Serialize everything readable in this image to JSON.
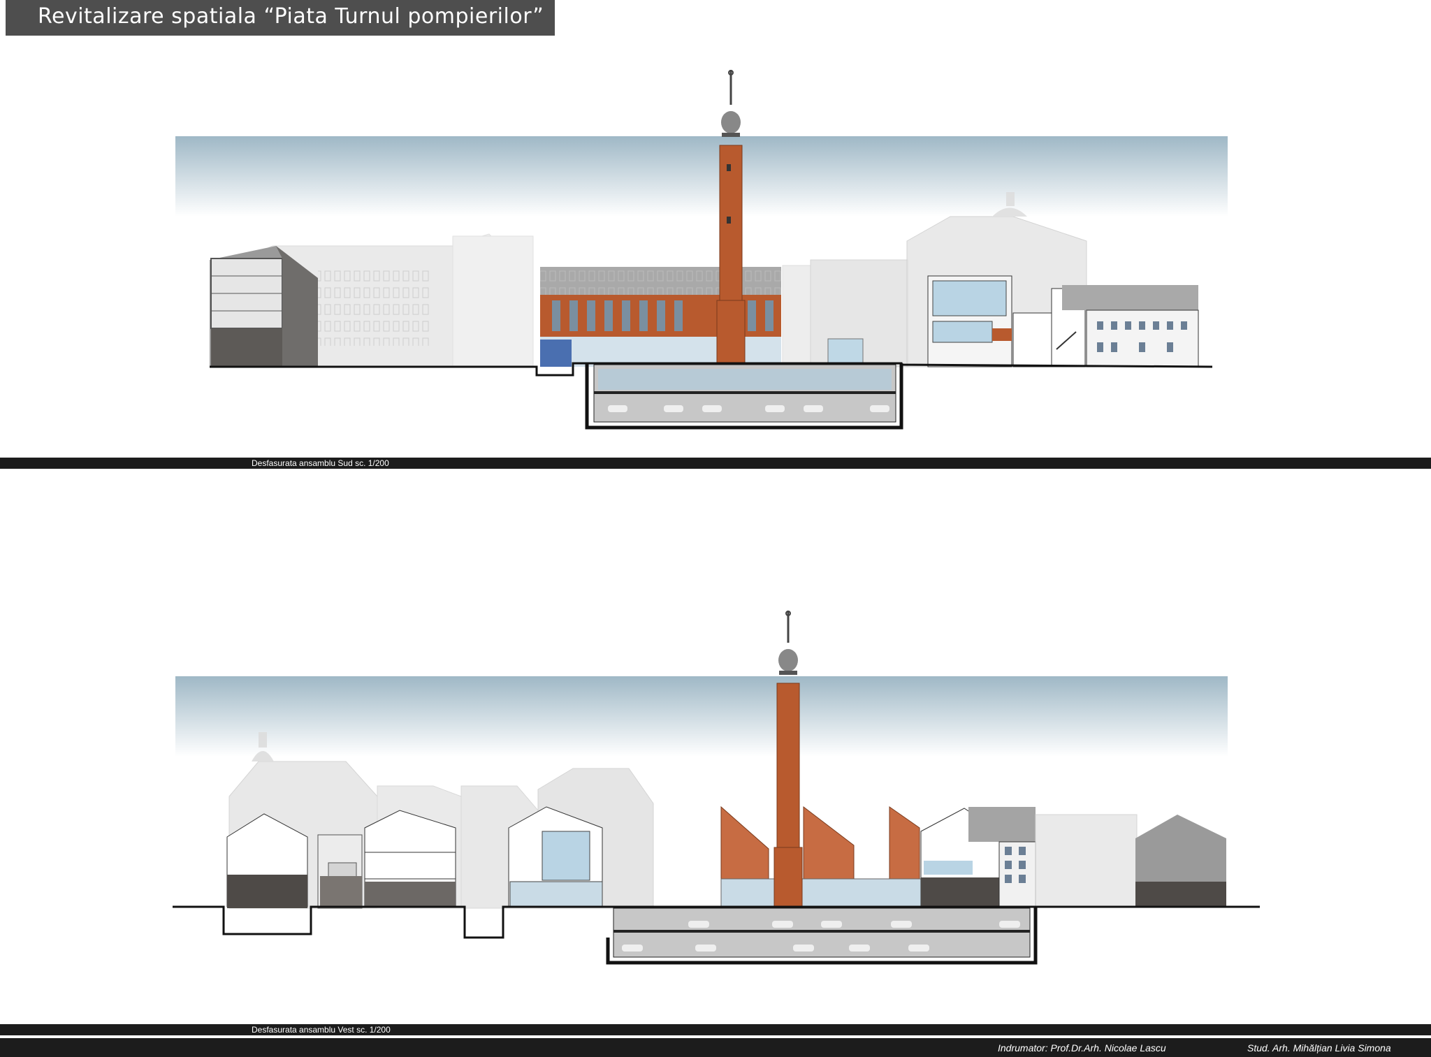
{
  "sheet": {
    "title": "Revitalizare spatiala “Piata Turnul pompierilor”"
  },
  "drawings": [
    {
      "caption": "Desfasurata ansamblu Sud  sc. 1/200"
    },
    {
      "caption": "Desfasurata ansamblu Vest  sc. 1/200"
    }
  ],
  "footer": {
    "tutor": "Indrumator: Prof.Dr.Arh. Nicolae Lascu",
    "student": "Stud. Arh. Mihălțian Livia Simona"
  },
  "colors": {
    "sky_top": "#9fb8c6",
    "brick": "#b85a2e",
    "ghost": "#e4e4e4",
    "dark": "#1c1c1c",
    "title_bg": "#4e4e4e",
    "glass": "#b9d4e4"
  }
}
